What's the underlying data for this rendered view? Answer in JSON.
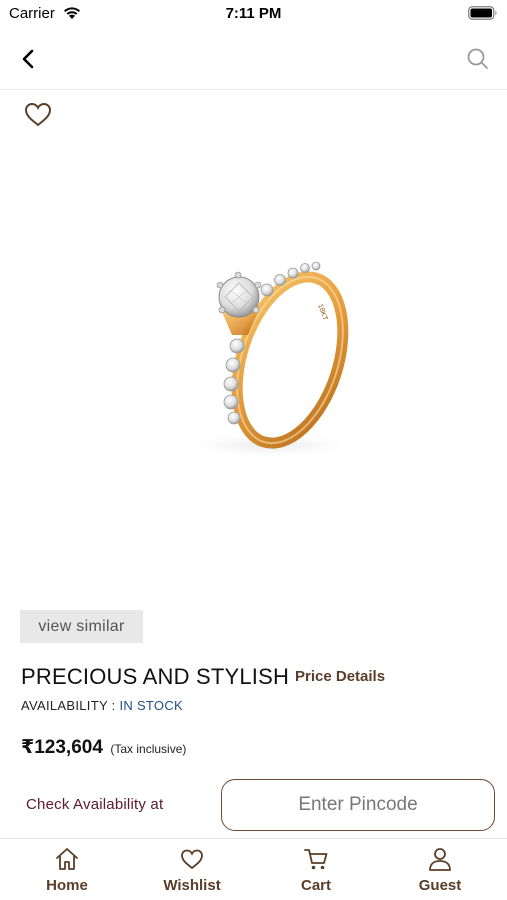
{
  "status_bar": {
    "carrier": "Carrier",
    "time": "7:11 PM"
  },
  "nav": {
    "back_icon": "chevron-left-icon",
    "search_icon": "search-icon"
  },
  "wishlist_toggle": {
    "icon": "heart-outline-icon"
  },
  "product": {
    "view_similar_label": "view similar",
    "title": "PRECIOUS AND STYLISH",
    "price_details_label": "Price Details",
    "availability_label": "AVAILABILITY : ",
    "availability_value": "IN STOCK",
    "price": "₹123,604",
    "tax_note": "(Tax inclusive)"
  },
  "pincode_check": {
    "label": "Check Availability at",
    "placeholder": "Enter Pincode",
    "value": ""
  },
  "tab_bar": {
    "items": [
      {
        "label": "Home",
        "icon": "home-icon"
      },
      {
        "label": "Wishlist",
        "icon": "heart-icon"
      },
      {
        "label": "Cart",
        "icon": "cart-icon"
      },
      {
        "label": "Guest",
        "icon": "user-icon"
      }
    ]
  },
  "colors": {
    "brand_brown": "#5a3e28",
    "maroon": "#5c1a2a",
    "in_stock_blue": "#1f4f8c",
    "chip_gray": "#e8e8e8"
  }
}
